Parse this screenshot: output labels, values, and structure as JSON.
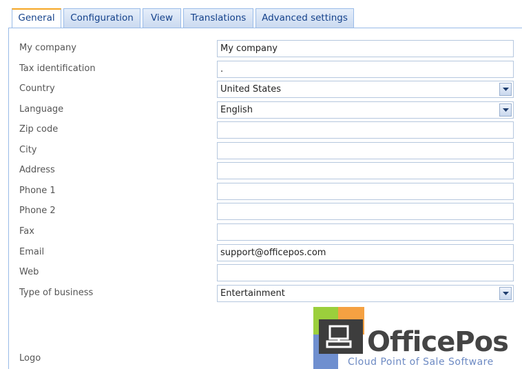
{
  "tabs": [
    {
      "label": "General",
      "active": true
    },
    {
      "label": "Configuration",
      "active": false
    },
    {
      "label": "View",
      "active": false
    },
    {
      "label": "Translations",
      "active": false
    },
    {
      "label": "Advanced settings",
      "active": false
    }
  ],
  "form": {
    "my_company": {
      "label": "My company",
      "value": "My company"
    },
    "tax_id": {
      "label": "Tax identification",
      "value": "."
    },
    "country": {
      "label": "Country",
      "value": "United States"
    },
    "language": {
      "label": "Language",
      "value": "English"
    },
    "zip": {
      "label": "Zip code",
      "value": ""
    },
    "city": {
      "label": "City",
      "value": ""
    },
    "address": {
      "label": "Address",
      "value": ""
    },
    "phone1": {
      "label": "Phone 1",
      "value": ""
    },
    "phone2": {
      "label": "Phone 2",
      "value": ""
    },
    "fax": {
      "label": "Fax",
      "value": ""
    },
    "email": {
      "label": "Email",
      "value": "support@officepos.com"
    },
    "web": {
      "label": "Web",
      "value": ""
    },
    "business_type": {
      "label": "Type of business",
      "value": "Entertainment"
    },
    "logo": {
      "label": "Logo"
    }
  },
  "logo_image": {
    "brand": "OfficePos",
    "tagline": "Cloud Point of Sale Software",
    "colors": {
      "green": "#9bcf3c",
      "orange": "#f5a142",
      "blue": "#6f8fcf",
      "dark": "#3d3d3d"
    }
  },
  "colors": {
    "tab_border": "#99bbe8",
    "tab_text": "#15428b",
    "active_accent": "#f5a623"
  }
}
